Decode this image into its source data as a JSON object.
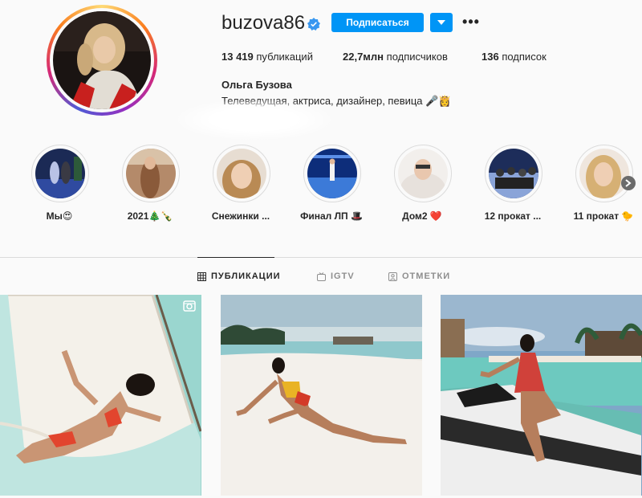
{
  "profile": {
    "username": "buzova86",
    "follow_label": "Подписаться",
    "stats": {
      "posts": "13 419",
      "posts_label": "публикаций",
      "followers": "22,7млн",
      "followers_label": "подписчиков",
      "following": "136",
      "following_label": "подписок"
    },
    "full_name": "Ольга Бузова",
    "bio": "Телеведущая, актриса, дизайнер, певица 🎤👸"
  },
  "highlights": [
    {
      "label": "Мы😍"
    },
    {
      "label": "2021🎄🍾"
    },
    {
      "label": "Снежинки ..."
    },
    {
      "label": "Финал ЛП 🎩"
    },
    {
      "label": "Дом2 ❤️"
    },
    {
      "label": "12 прокат ..."
    },
    {
      "label": "11 прокат 🐤"
    }
  ],
  "tabs": [
    {
      "label": "ПУБЛИКАЦИИ",
      "icon": "grid-icon",
      "active": true
    },
    {
      "label": "IGTV",
      "icon": "igtv-icon",
      "active": false
    },
    {
      "label": "ОТМЕТКИ",
      "icon": "tagged-icon",
      "active": false
    }
  ],
  "posts": [
    {
      "type": "reel",
      "icon": "reel-icon"
    },
    {
      "type": "photo"
    },
    {
      "type": "photo"
    }
  ],
  "colors": {
    "accent": "#0095f6",
    "text": "#262626",
    "muted": "#8e8e8e",
    "border": "#dbdbdb",
    "background": "#fafafa"
  }
}
